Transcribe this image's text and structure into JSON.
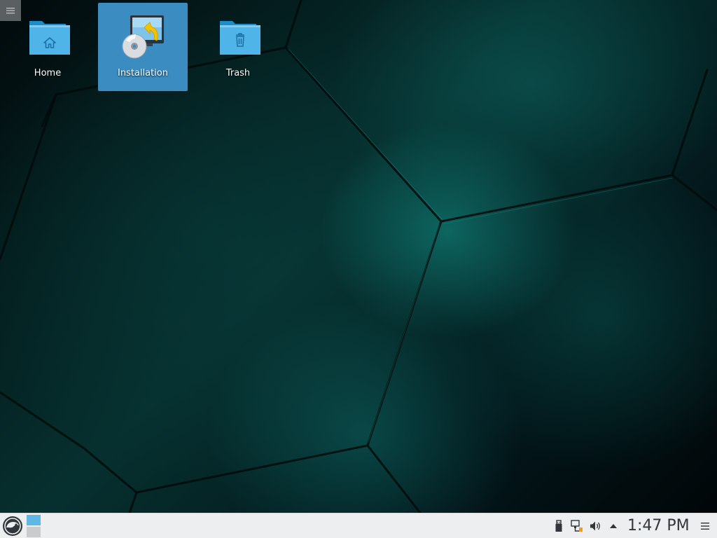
{
  "desktop": {
    "icons": [
      {
        "label": "Home",
        "icon": "home-folder-icon",
        "selected": false
      },
      {
        "label": "Installation",
        "icon": "installer-disc-icon",
        "selected": true
      },
      {
        "label": "Trash",
        "icon": "trash-folder-icon",
        "selected": false
      }
    ]
  },
  "taskbar": {
    "launcher_icon": "opensuse-gecko-icon",
    "pager": {
      "desktops": 2,
      "active": 1
    },
    "tray": [
      "usb-device-icon",
      "network-icon",
      "volume-icon",
      "expand-tray-arrow-icon"
    ],
    "clock": "1:47 PM",
    "menu_icon": "hamburger-menu-icon"
  },
  "colors": {
    "selection": "#3b8dc1",
    "folder_blue": "#4fb4e8",
    "panel_bg": "#eceeef",
    "text_dark": "#31363b"
  }
}
